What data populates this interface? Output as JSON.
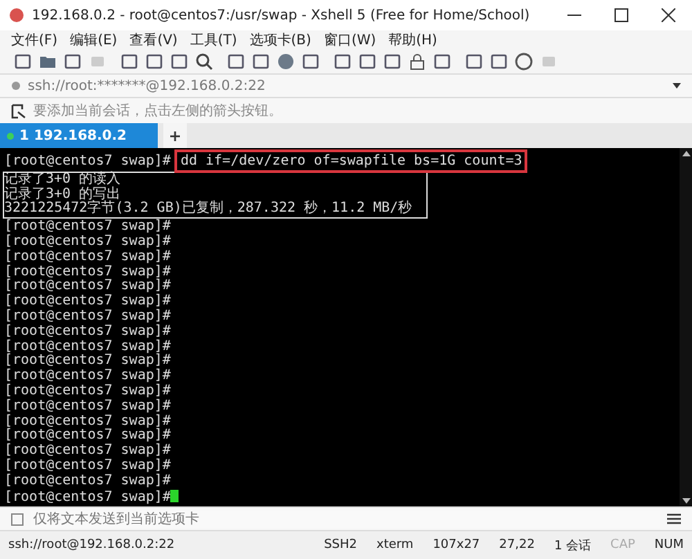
{
  "window": {
    "title": "192.168.0.2 - root@centos7:/usr/swap - Xshell 5 (Free for Home/School)"
  },
  "menu": [
    "文件(F)",
    "编辑(E)",
    "查看(V)",
    "工具(T)",
    "选项卡(B)",
    "窗口(W)",
    "帮助(H)"
  ],
  "address_bar": {
    "value": "ssh://root:*******@192.168.0.2:22"
  },
  "hint_bar": {
    "text": "要添加当前会话，点击左侧的箭头按钮。"
  },
  "tabs": [
    {
      "label": "1 192.168.0.2",
      "selected": true
    }
  ],
  "terminal": {
    "prompt": "[root@centos7 swap]#",
    "command": "dd if=/dev/zero of=swapfile bs=1G count=3",
    "output": [
      "记录了3+0 的读入",
      "记录了3+0 的写出",
      "3221225472字节(3.2 GB)已复制，287.322 秒，11.2 MB/秒"
    ],
    "prompt_lines": [
      "[root@centos7 swap]#",
      "[root@centos7 swap]#",
      "[root@centos7 swap]#",
      "[root@centos7 swap]#",
      "[root@centos7 swap]#",
      "[root@centos7 swap]#",
      "[root@centos7 swap]#",
      "[root@centos7 swap]#",
      "[root@centos7 swap]#",
      "[root@centos7 swap]#",
      "[root@centos7 swap]#",
      "[root@centos7 swap]#",
      "[root@centos7 swap]#",
      "[root@centos7 swap]#",
      "[root@centos7 swap]#",
      "[root@centos7 swap]#",
      "[root@centos7 swap]#",
      "[root@centos7 swap]#",
      "[root@centos7 swap]#"
    ],
    "cursor": true
  },
  "compose_bar": {
    "placeholder": "仅将文本发送到当前选项卡"
  },
  "status_bar": {
    "address": "ssh://root@192.168.0.2:22",
    "items": [
      {
        "text": "SSH2",
        "on": true
      },
      {
        "text": "xterm",
        "on": true
      },
      {
        "text": "107x27",
        "on": true
      },
      {
        "text": "27,22",
        "on": true
      },
      {
        "text": "1 会话",
        "on": true
      },
      {
        "text": "CAP",
        "on": false
      },
      {
        "text": "NUM",
        "on": true
      }
    ]
  }
}
